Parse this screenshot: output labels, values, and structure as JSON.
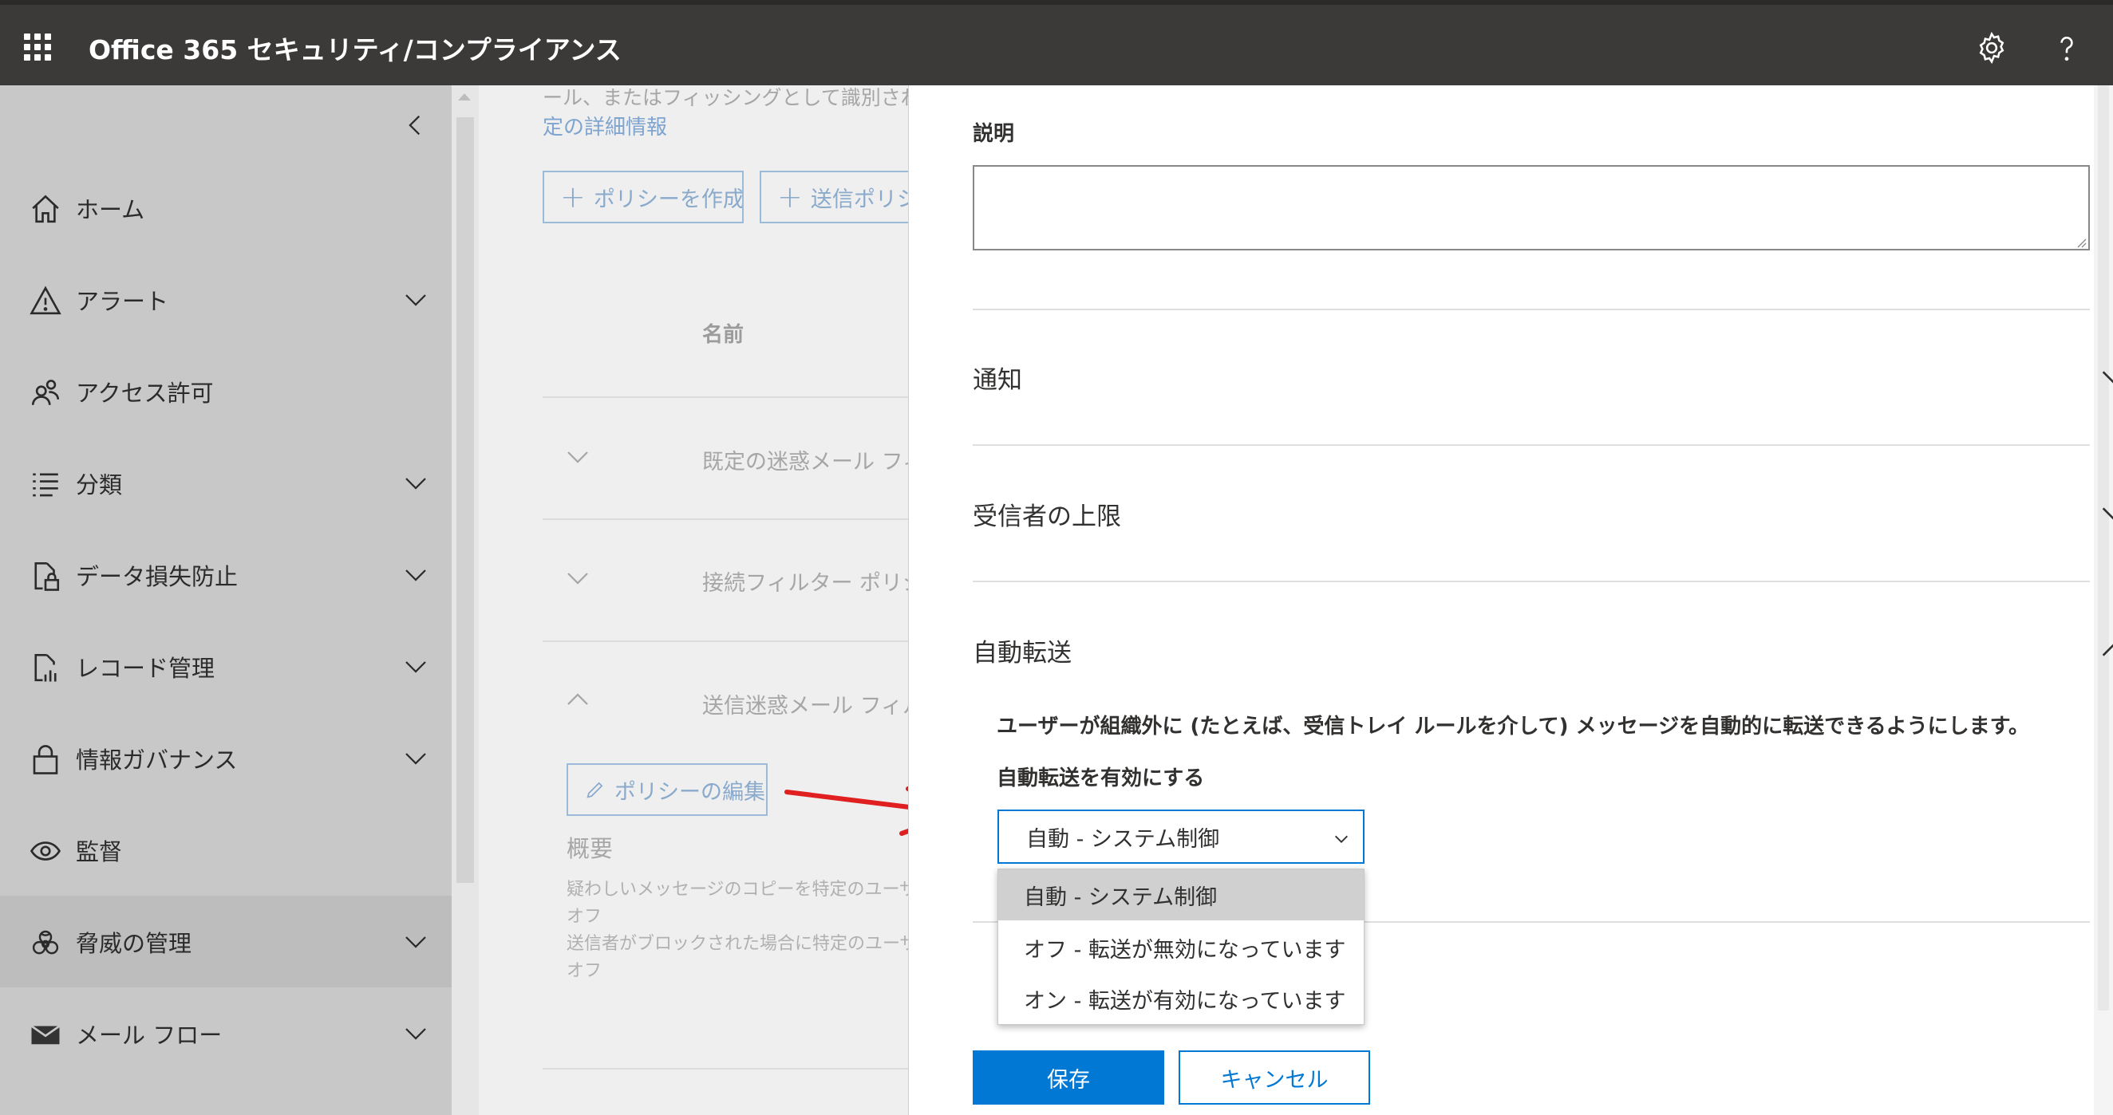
{
  "app": {
    "title": "Office 365 セキュリティ/コンプライアンス"
  },
  "header": {
    "settings_icon": "gear-icon",
    "help_icon": "help-icon"
  },
  "nav": {
    "items": [
      {
        "label": "ホーム",
        "icon": "home-icon",
        "expandable": false
      },
      {
        "label": "アラート",
        "icon": "alert-icon",
        "expandable": true
      },
      {
        "label": "アクセス許可",
        "icon": "people-icon",
        "expandable": false
      },
      {
        "label": "分類",
        "icon": "list-icon",
        "expandable": true
      },
      {
        "label": "データ損失防止",
        "icon": "document-lock-icon",
        "expandable": true
      },
      {
        "label": "レコード管理",
        "icon": "chart-doc-icon",
        "expandable": true
      },
      {
        "label": "情報ガバナンス",
        "icon": "lock-icon",
        "expandable": true
      },
      {
        "label": "監督",
        "icon": "eye-icon",
        "expandable": false
      },
      {
        "label": "脅威の管理",
        "icon": "biohazard-icon",
        "expandable": true,
        "active": true
      },
      {
        "label": "メール フロー",
        "icon": "mail-icon",
        "expandable": true
      }
    ]
  },
  "main": {
    "desc_partial": "ール、またはフィッシングとして識別されたメッ",
    "desc_link": "定の詳細情報",
    "create_policy_button": "ポリシーを作成",
    "outbound_policy_button": "送信ポリシー",
    "column_name": "名前",
    "rows": [
      {
        "name": "既定の迷惑メール フィルター"
      },
      {
        "name": "接続フィルター ポリシー"
      },
      {
        "name": "送信迷惑メール フィルター"
      }
    ],
    "edit_policy_button": "ポリシーの編集",
    "summary_title": "概要",
    "summary_lines": [
      "疑わしいメッセージのコピーを特定のユーザーに",
      "オフ",
      "送信者がブロックされた場合に特定のユーザー",
      "オフ"
    ]
  },
  "panel": {
    "description_label": "説明",
    "sections": [
      {
        "title": "通知",
        "expanded": false
      },
      {
        "title": "受信者の上限",
        "expanded": false
      },
      {
        "title": "自動転送",
        "expanded": true
      }
    ],
    "forwarding": {
      "description": "ユーザーが組織外に (たとえば、受信トレイ ルールを介して) メッセージを自動的に転送できるようにします。",
      "enable_label": "自動転送を有効にする",
      "selected": "自動 - システム制御",
      "options": [
        "自動 - システム制御",
        "オフ - 転送が無効になっています",
        "オン - 転送が有効になっています"
      ]
    },
    "save_button": "保存",
    "cancel_button": "キャンセル"
  },
  "colors": {
    "topbar": "#3b3a39",
    "nav_bg": "#c8c8c8",
    "accent": "#0078d4",
    "arrow": "#e02020"
  }
}
